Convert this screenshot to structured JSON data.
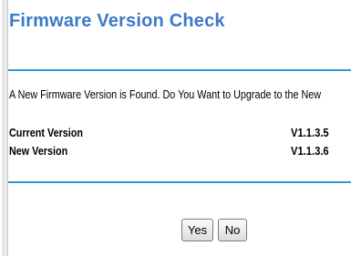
{
  "page": {
    "title": "Firmware Version Check",
    "message": "A New Firmware Version is Found. Do You Want to Upgrade to the New"
  },
  "versions": {
    "current": {
      "label": "Current Version",
      "value": "V1.1.3.5"
    },
    "new": {
      "label": "New Version",
      "value": "V1.1.3.6"
    }
  },
  "buttons": {
    "yes": "Yes",
    "no": "No"
  }
}
